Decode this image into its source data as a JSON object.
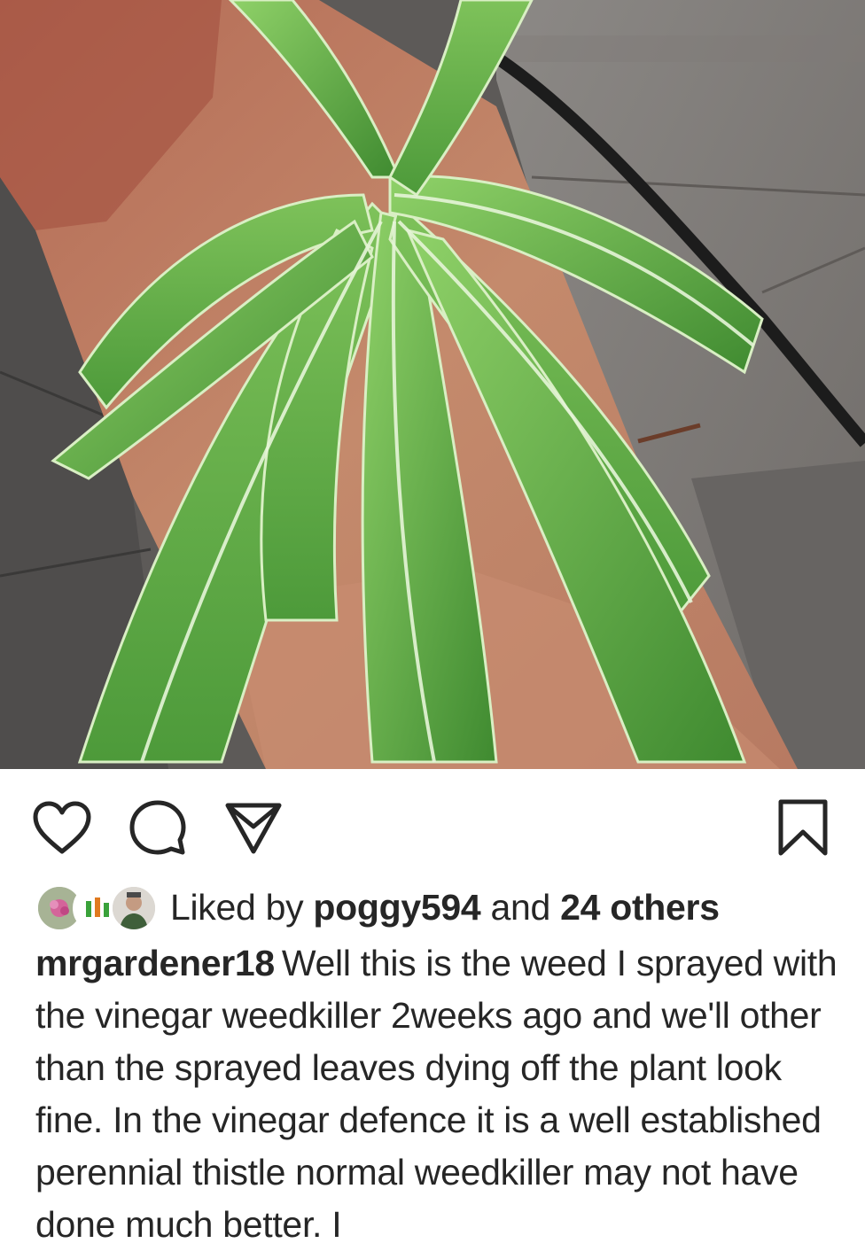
{
  "post": {
    "image_alt": "Thistle plant growing between brick and paving slabs",
    "actions": {
      "like_icon": "heart-icon",
      "comment_icon": "comment-icon",
      "share_icon": "paper-plane-icon",
      "save_icon": "bookmark-icon"
    },
    "likes": {
      "prefix": "Liked by",
      "user": "poggy594",
      "middle": "and",
      "others": "24 others"
    },
    "caption": {
      "username": "mrgardener18",
      "text": "Well this is the weed I sprayed with the vinegar weedkiller 2weeks ago and we'll other than the sprayed leaves dying off the plant look fine. In the vinegar defence it is a well established perennial thistle normal weedkiller may not have done much better. I"
    }
  }
}
